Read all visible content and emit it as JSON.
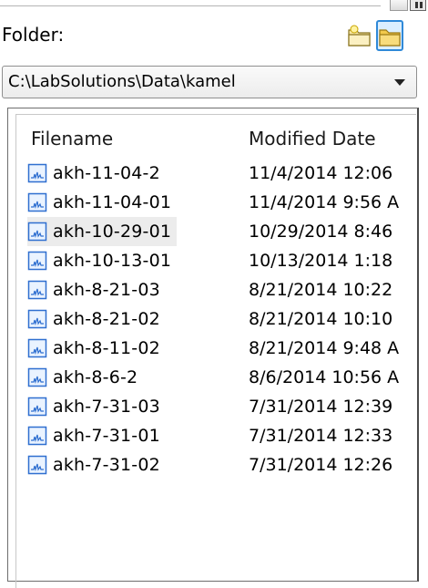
{
  "folder_label": "Folder:",
  "path_value": "C:\\LabSolutions\\Data\\kamel",
  "columns": {
    "filename": "Filename",
    "modified": "Modified Date"
  },
  "files": [
    {
      "name": "akh-11-04-2",
      "date": "11/4/2014 12:06"
    },
    {
      "name": "akh-11-04-01",
      "date": "11/4/2014 9:56 A"
    },
    {
      "name": "akh-10-29-01",
      "date": "10/29/2014 8:46",
      "selected": true
    },
    {
      "name": "akh-10-13-01",
      "date": "10/13/2014 1:18"
    },
    {
      "name": "akh-8-21-03",
      "date": "8/21/2014 10:22"
    },
    {
      "name": "akh-8-21-02",
      "date": "8/21/2014 10:10"
    },
    {
      "name": "akh-8-11-02",
      "date": "8/21/2014 9:48 A"
    },
    {
      "name": "akh-8-6-2",
      "date": "8/6/2014 10:56 A"
    },
    {
      "name": "akh-7-31-03",
      "date": "7/31/2014 12:39"
    },
    {
      "name": "akh-7-31-01",
      "date": "7/31/2014 12:33"
    },
    {
      "name": "akh-7-31-02",
      "date": "7/31/2014 12:26"
    }
  ],
  "icons": {
    "new_folder": "new-folder-icon",
    "open_folder": "open-folder-icon",
    "file": "chromatogram-file-icon"
  },
  "colors": {
    "selection": "#ececec",
    "icon_blue": "#2f6fd0",
    "folder_yellow": "#f5d76e"
  }
}
